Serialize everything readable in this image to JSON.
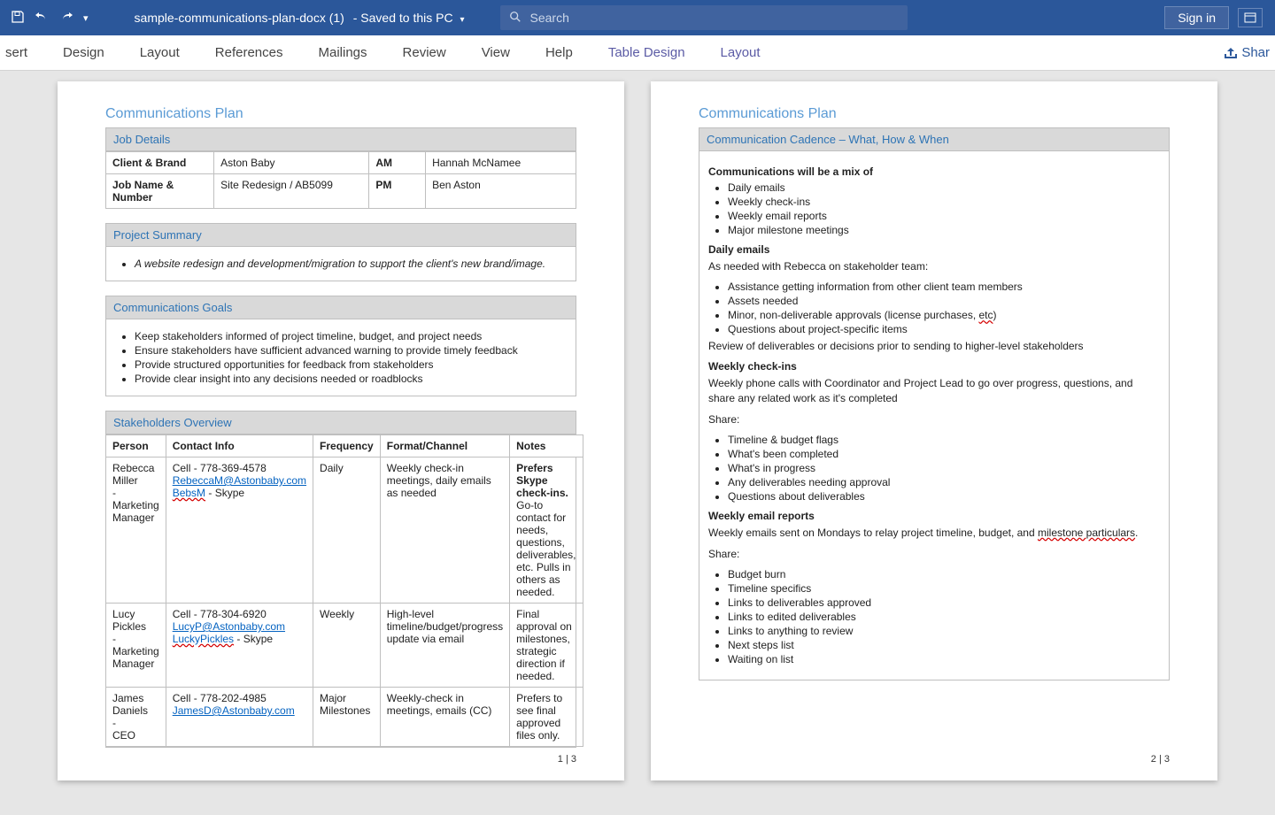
{
  "titlebar": {
    "doc_name": "sample-communications-plan-docx (1)",
    "saved_status": "Saved to this PC",
    "search_placeholder": "Search",
    "signin": "Sign in"
  },
  "ribbon": {
    "tabs": [
      "sert",
      "Design",
      "Layout",
      "References",
      "Mailings",
      "Review",
      "View",
      "Help"
    ],
    "context_tabs": [
      "Table Design",
      "Layout"
    ],
    "share": "Shar"
  },
  "page1": {
    "title": "Communications Plan",
    "job_details": {
      "header": "Job Details",
      "labels": {
        "client": "Client & Brand",
        "am": "AM",
        "job": "Job Name & Number",
        "pm": "PM"
      },
      "values": {
        "client": "Aston Baby",
        "am": "Hannah McNamee",
        "job": "Site Redesign / AB5099",
        "pm": "Ben Aston"
      }
    },
    "summary": {
      "header": "Project Summary",
      "bullet": "A website redesign and development/migration to support the client's new brand/image."
    },
    "goals": {
      "header": "Communications Goals",
      "items": [
        "Keep stakeholders informed of project timeline, budget, and project needs",
        "Ensure stakeholders have sufficient advanced warning to provide timely feedback",
        "Provide structured opportunities for feedback from stakeholders",
        "Provide clear insight into any decisions needed or roadblocks"
      ]
    },
    "stakeholders": {
      "header": "Stakeholders Overview",
      "cols": [
        "Person",
        "Contact Info",
        "Frequency",
        "Format/Channel",
        "Notes"
      ],
      "rows": [
        {
          "person_name": "Rebecca Miller",
          "person_title": "Marketing Manager",
          "cell": "Cell - 778-369-4578",
          "email": "RebeccaM@Astonbaby.com",
          "skype": "BebsM",
          "skype_suffix": " - Skype",
          "freq": "Daily",
          "format": "Weekly check-in meetings, daily emails as needed",
          "notes_bold": "Prefers Skype check-ins.",
          "notes_rest": "Go-to contact for needs, questions, deliverables, etc. Pulls in others as needed."
        },
        {
          "person_name": "Lucy Pickles",
          "person_title": "Marketing Manager",
          "cell": "Cell - 778-304-6920",
          "email": "LucyP@Astonbaby.com",
          "skype": "LuckyPickles",
          "skype_suffix": " - Skype",
          "freq": "Weekly",
          "format": "High-level timeline/budget/progress update via email",
          "notes_bold": "",
          "notes_rest": "Final approval on milestones, strategic direction if needed."
        },
        {
          "person_name": "James Daniels",
          "person_title": "CEO",
          "cell": "Cell - 778-202-4985",
          "email": "JamesD@Astonbaby.com",
          "skype": "",
          "skype_suffix": "",
          "freq": "Major Milestones",
          "format": "Weekly-check in meetings, emails (CC)",
          "notes_bold": "",
          "notes_rest": "Prefers to see final approved files only."
        }
      ]
    },
    "pagenum": "1 | 3"
  },
  "page2": {
    "title": "Communications Plan",
    "cadence_header": "Communication Cadence – What, How & When",
    "mix_intro": "Communications will be a mix of",
    "mix_items": [
      "Daily emails",
      "Weekly check-ins",
      "Weekly email reports",
      "Major milestone meetings"
    ],
    "daily": {
      "h": "Daily emails",
      "p1": "As needed with Rebecca on stakeholder team:",
      "items": [
        "Assistance getting information from other client team members",
        "Assets needed",
        "Minor, non-deliverable approvals (license purchases, etc)",
        "Questions about project-specific items"
      ],
      "p2": "Review of deliverables or decisions prior to sending to higher-level stakeholders"
    },
    "weekly_checkins": {
      "h": "Weekly check-ins",
      "p1": "Weekly phone calls with Coordinator and Project Lead to go over progress, questions, and share any related work as it's completed",
      "share": "Share:",
      "items": [
        "Timeline & budget flags",
        "What's been completed",
        "What's in progress",
        "Any deliverables needing approval",
        "Questions about deliverables"
      ]
    },
    "weekly_reports": {
      "h": "Weekly email reports",
      "p1_a": "Weekly emails sent on Mondays to relay project timeline, budget, and ",
      "p1_err": "milestone particulars",
      "p1_b": ".",
      "share": "Share:",
      "items": [
        "Budget burn",
        "Timeline specifics",
        "Links to deliverables approved",
        "Links to edited deliverables",
        "Links to anything to review",
        "Next steps list",
        "Waiting on list"
      ]
    },
    "pagenum": "2 | 3"
  }
}
